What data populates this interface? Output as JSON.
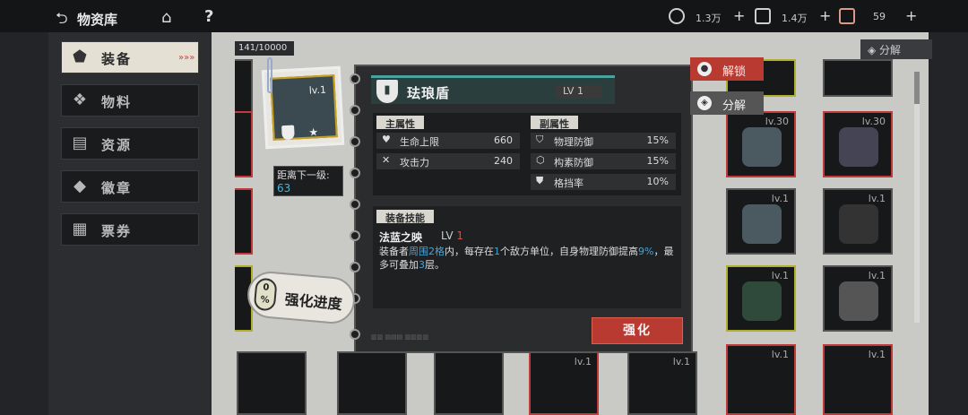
{
  "topbar": {
    "title": "物资库",
    "resources": [
      {
        "icon": "gear-coin-icon",
        "value": "1.3万"
      },
      {
        "icon": "alloy-icon",
        "value": "1.4万"
      },
      {
        "icon": "ticket-icon",
        "value": "59"
      }
    ]
  },
  "sidebar": {
    "items": [
      {
        "label": "装备",
        "icon": "equipment-icon",
        "active": true
      },
      {
        "label": "物料",
        "icon": "materials-icon"
      },
      {
        "label": "资源",
        "icon": "resources-icon"
      },
      {
        "label": "徽章",
        "icon": "badge-icon"
      },
      {
        "label": "票券",
        "icon": "ticket-icon"
      }
    ]
  },
  "inventory": {
    "count_current": "141",
    "count_total": "10000",
    "decompose_label": "分解",
    "visible_levels": [
      "lv.30",
      "lv.30",
      "lv.1",
      "lv.1",
      "lv.1",
      "lv.1",
      "lv.1",
      "lv.1",
      "lv.1",
      "lv.1"
    ]
  },
  "item": {
    "name": "珐琅盾",
    "level": "LV 1",
    "card_level": "lv.1",
    "next_level_label": "距离下一级:",
    "next_level_value": "63"
  },
  "main_attr": {
    "title": "主属性",
    "rows": [
      {
        "name": "生命上限",
        "value": "660",
        "icon": "heart-icon"
      },
      {
        "name": "攻击力",
        "value": "240",
        "icon": "crossed-swords-icon"
      }
    ]
  },
  "sub_attr": {
    "title": "副属性",
    "rows": [
      {
        "name": "物理防御",
        "value": "15%",
        "icon": "shield-icon"
      },
      {
        "name": "构素防御",
        "value": "15%",
        "icon": "crystal-shield-icon"
      },
      {
        "name": "格挡率",
        "value": "10%",
        "icon": "block-icon"
      }
    ]
  },
  "skill": {
    "title": "装备技能",
    "name": "法蓝之映",
    "lv_prefix": "LV",
    "lv_value": "1",
    "desc": {
      "p1": "装备者",
      "h1": "周围2格",
      "p2": "内，每存在",
      "h2": "1",
      "p3": "个敌方单位，自身物理防御提高",
      "h3": "9%",
      "p4": "，最多可叠加",
      "h4": "3",
      "p5": "层。"
    }
  },
  "progress": {
    "value": "0",
    "unit": "%",
    "label": "强化进度"
  },
  "actions": {
    "enhance": "强化",
    "unlock": "解锁",
    "decompose": "分解"
  },
  "colors": {
    "accent": "#4aa3a0",
    "enhance": "#b93a30",
    "highlight": "#4aa3d8"
  }
}
